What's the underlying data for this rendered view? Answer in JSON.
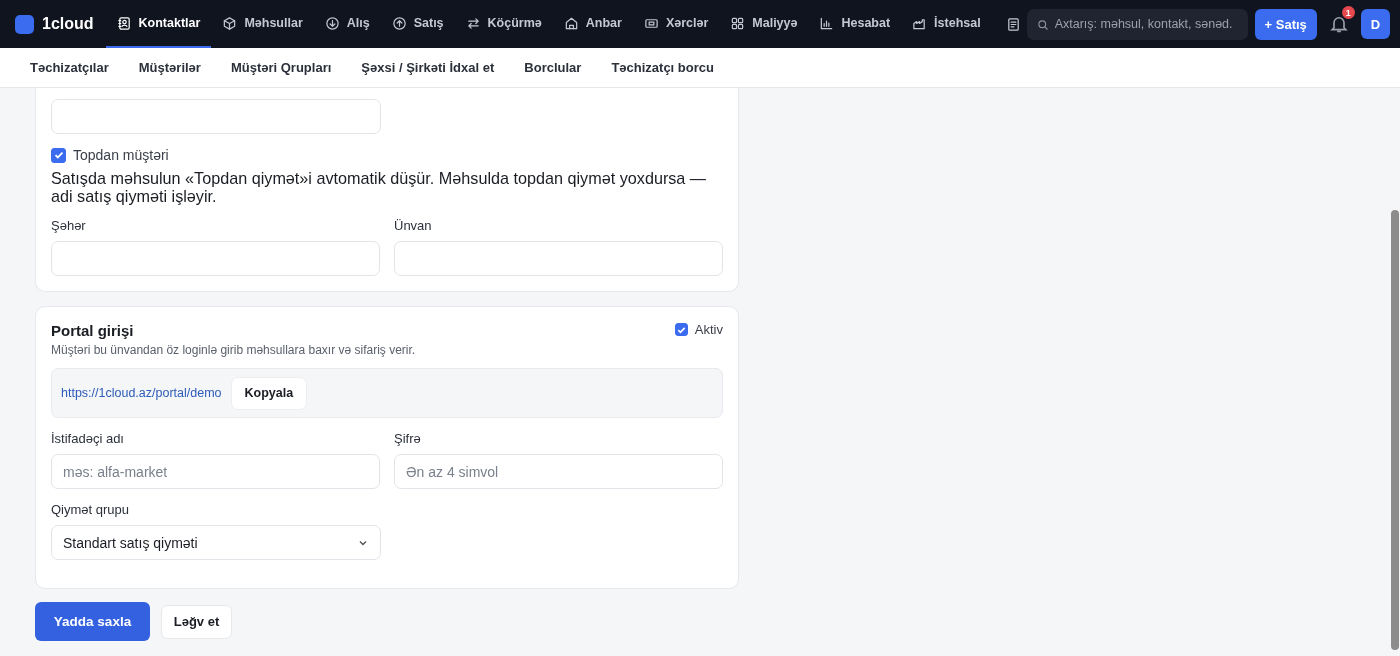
{
  "logo": "1cloud",
  "nav": [
    {
      "label": "Kontaktlar",
      "selected": true
    },
    {
      "label": "Məhsullar",
      "selected": false
    },
    {
      "label": "Alış",
      "selected": false
    },
    {
      "label": "Satış",
      "selected": false
    },
    {
      "label": "Köçürmə",
      "selected": false
    },
    {
      "label": "Anbar",
      "selected": false
    },
    {
      "label": "Xərclər",
      "selected": false
    },
    {
      "label": "Maliyyə",
      "selected": false
    },
    {
      "label": "Hesabat",
      "selected": false
    },
    {
      "label": "İstehsal",
      "selected": false
    }
  ],
  "search": {
    "placeholder": "Axtarış: məhsul, kontakt, sənəd."
  },
  "new_sale_button": "+ Satış",
  "notifications": {
    "count": "1"
  },
  "avatar": "D",
  "subnav": [
    {
      "label": "Təchizatçılar"
    },
    {
      "label": "Müştərilər"
    },
    {
      "label": "Müştəri Qrupları"
    },
    {
      "label": "Şəxsi / Şirkəti İdxal et"
    },
    {
      "label": "Borclular"
    },
    {
      "label": "Təchizatçı borcu"
    }
  ],
  "details_card": {
    "wholesale": {
      "label": "Topdan müştəri",
      "checked": true
    },
    "note": "Satışda məhsulun «Topdan qiymət»i avtomatik düşür. Məhsulda topdan qiymət yoxdursa — adi satış qiyməti işləyir.",
    "fields": [
      {
        "label": "Şəhər"
      },
      {
        "label": "Ünvan"
      }
    ]
  },
  "portal_card": {
    "title": "Portal girişi",
    "subtitle": "Müştəri bu ünvandan öz loginlə girib məhsullara baxır və sifariş verir.",
    "active": {
      "label": "Aktiv",
      "checked": true
    },
    "link": "https://1cloud.az/portal/demo",
    "copy_button": "Kopyala",
    "fields": [
      {
        "label": "İstifadəçi adı",
        "placeholder": "məs: alfa-market"
      },
      {
        "label": "Şifrə",
        "placeholder": "Ən az 4 simvol"
      }
    ],
    "price_group": {
      "label": "Qiymət qrupu",
      "value": "Standart satış qiyməti"
    }
  },
  "buttons": {
    "save": "Yadda saxla",
    "cancel": "Ləğv et"
  }
}
